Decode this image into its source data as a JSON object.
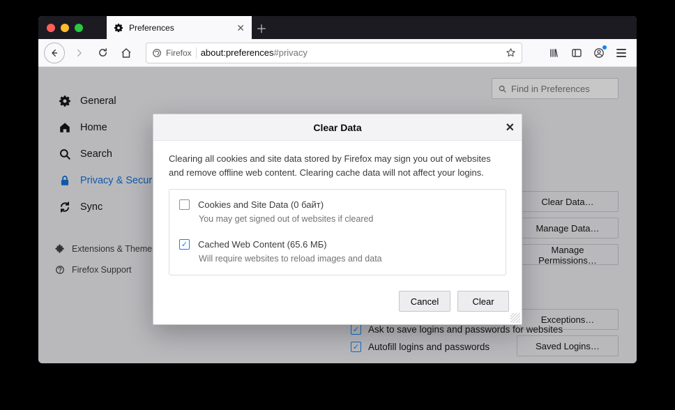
{
  "tab": {
    "title": "Preferences"
  },
  "url": {
    "identity": "Firefox",
    "origin": "about:preferences",
    "fragment": "#privacy"
  },
  "search": {
    "placeholder": "Find in Preferences"
  },
  "sidebar": {
    "items": [
      {
        "label": "General"
      },
      {
        "label": "Home"
      },
      {
        "label": "Search"
      },
      {
        "label": "Privacy & Security"
      },
      {
        "label": "Sync"
      }
    ],
    "footer": [
      {
        "label": "Extensions & Themes"
      },
      {
        "label": "Firefox Support"
      }
    ]
  },
  "buttons": {
    "clear_data": "Clear Data…",
    "manage_data": "Manage Data…",
    "manage_permissions": "Manage Permissions…",
    "exceptions": "Exceptions…",
    "saved_logins": "Saved Logins…"
  },
  "main_checks": {
    "ask_save": "Ask to save logins and passwords for websites",
    "autofill": "Autofill logins and passwords"
  },
  "dialog": {
    "title": "Clear Data",
    "intro": "Clearing all cookies and site data stored by Firefox may sign you out of websites and remove offline web content. Clearing cache data will not affect your logins.",
    "opt1": {
      "label": "Cookies and Site Data (0 байт)",
      "desc": "You may get signed out of websites if cleared"
    },
    "opt2": {
      "label": "Cached Web Content (65.6 МБ)",
      "desc": "Will require websites to reload images and data"
    },
    "cancel": "Cancel",
    "clear": "Clear"
  }
}
